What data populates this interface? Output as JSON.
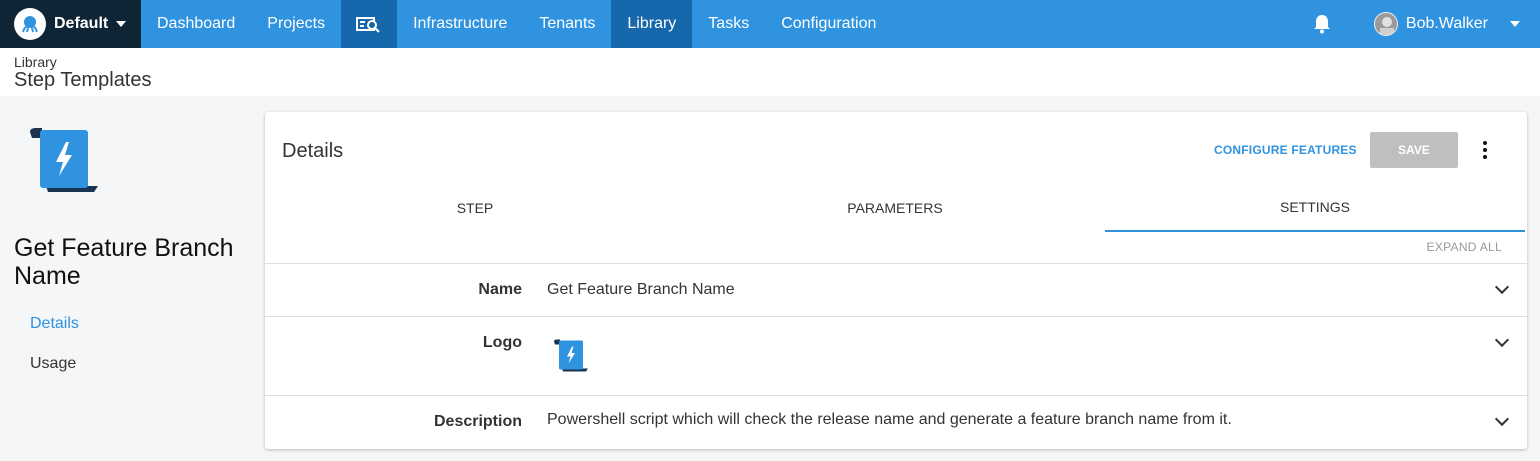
{
  "nav": {
    "space": "Default",
    "items": [
      "Dashboard",
      "Projects",
      "Infrastructure",
      "Tenants",
      "Library",
      "Tasks",
      "Configuration"
    ],
    "active": "Library",
    "user": "Bob.Walker"
  },
  "header": {
    "breadcrumb": "Library",
    "title": "Step Templates"
  },
  "sidebar": {
    "template_name": "Get Feature Branch Name",
    "links": {
      "details": "Details",
      "usage": "Usage"
    }
  },
  "card": {
    "title": "Details",
    "configure_label": "CONFIGURE FEATURES",
    "save_label": "SAVE",
    "tabs": [
      "STEP",
      "PARAMETERS",
      "SETTINGS"
    ],
    "active_tab": "SETTINGS",
    "expand_all": "EXPAND ALL",
    "rows": {
      "name": {
        "label": "Name",
        "value": "Get Feature Branch Name"
      },
      "logo": {
        "label": "Logo"
      },
      "description": {
        "label": "Description",
        "value": "Powershell script which will check the release name and generate a feature branch name from it."
      }
    }
  },
  "colors": {
    "brand": "#2f93e0",
    "nav_active": "#1667ab",
    "nav_dark": "#0f2535"
  }
}
